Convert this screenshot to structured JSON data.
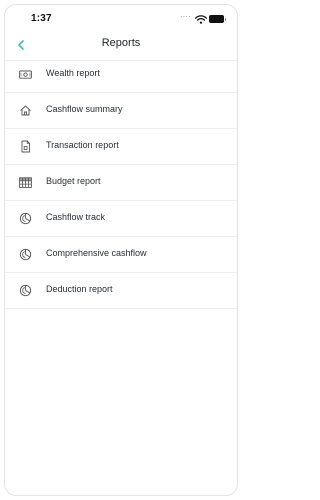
{
  "status_bar": {
    "time": "1:37",
    "signal_dots": "....",
    "wifi_icon": "wifi-icon",
    "battery_icon": "battery-icon"
  },
  "nav": {
    "back_icon": "chevron-left-icon",
    "title": "Reports"
  },
  "colors": {
    "accent": "#3fc1b0",
    "text": "#2b2f33",
    "divider": "#eeeeee"
  },
  "reports": [
    {
      "label": "Wealth report",
      "icon": "banknote-icon"
    },
    {
      "label": "Cashflow summary",
      "icon": "home-icon"
    },
    {
      "label": "Transaction report",
      "icon": "document-icon"
    },
    {
      "label": "Budget report",
      "icon": "grid-icon"
    },
    {
      "label": "Cashflow track",
      "icon": "pie-chart-icon"
    },
    {
      "label": "Comprehensive cashflow",
      "icon": "pie-chart-icon"
    },
    {
      "label": "Deduction report",
      "icon": "pie-chart-icon"
    }
  ]
}
